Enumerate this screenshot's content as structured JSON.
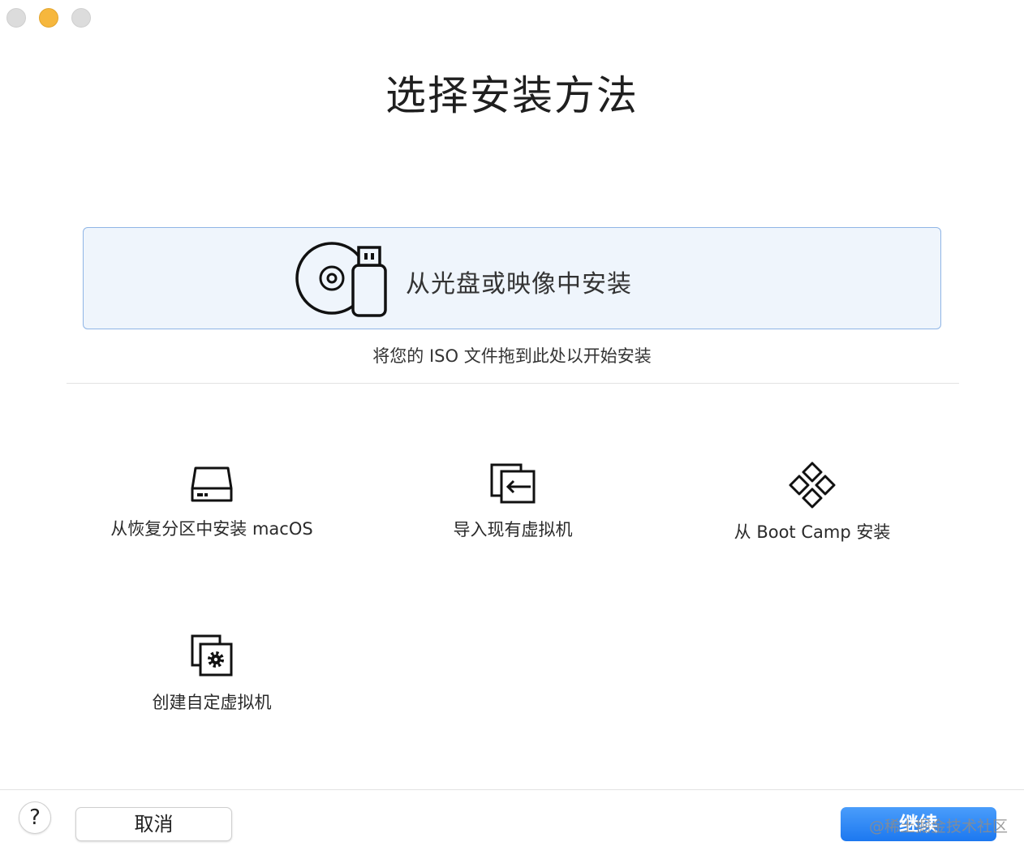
{
  "window": {
    "controls": [
      "close",
      "minimize",
      "zoom"
    ]
  },
  "page": {
    "title": "选择安装方法"
  },
  "iso_drop": {
    "label": "从光盘或映像中安装",
    "hint": "将您的 ISO 文件拖到此处以开始安装",
    "icon": "disc-and-usb-icon"
  },
  "options": [
    {
      "label": "从恢复分区中安装 macOS",
      "icon": "hard-drive-icon"
    },
    {
      "label": "导入现有虚拟机",
      "icon": "import-vm-icon"
    },
    {
      "label": "从 Boot Camp 安装",
      "icon": "boot-camp-icon"
    },
    {
      "label": "创建自定虚拟机",
      "icon": "custom-vm-gear-icon"
    }
  ],
  "footer": {
    "help": "?",
    "cancel": "取消",
    "continue": "继续"
  },
  "watermark": "@稀土掘金技术社区",
  "colors": {
    "accent": "#1c78f0",
    "selection_bg": "#eff5fc",
    "selection_border": "#8fb5e6",
    "minimize": "#f6b73d"
  }
}
